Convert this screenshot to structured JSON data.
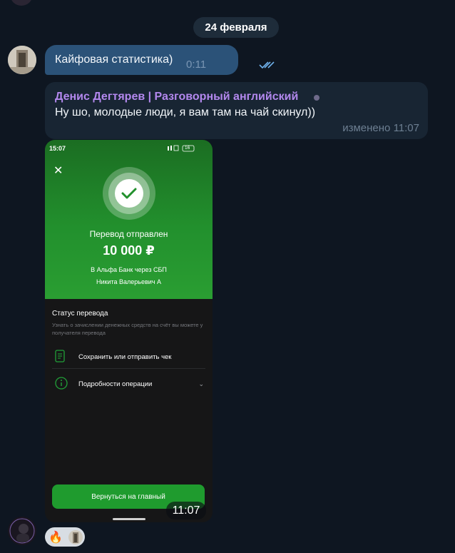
{
  "date_divider": "24 февраля",
  "messages": {
    "outgoing": {
      "text": "Кайфовая статистика)",
      "time": "0:11"
    },
    "incoming": {
      "sender": "Денис Дегтярев | Разговорный английский",
      "text": "Ну шо, молодые люди, я вам там на чай скинул))",
      "edited": "изменено 11:07"
    },
    "photo": {
      "time": "11:07",
      "screen": {
        "status_time": "15:07",
        "status_icons": "16",
        "title": "Перевод отправлен",
        "amount": "10 000 ₽",
        "bank": "В Альфа Банк через СБП",
        "recipient": "Никита Валерьевич А",
        "status_title": "Статус перевода",
        "status_desc": "Узнать о зачислении денежных средств на счёт вы можете у получателя перевода",
        "row_receipt": "Сохранить или отправить чек",
        "row_details": "Подробности операции",
        "return_button": "Вернуться на главный"
      }
    },
    "reaction": {
      "emoji": "🔥"
    }
  },
  "colors": {
    "background": "#0e1621",
    "bubble_in": "#182533",
    "bubble_out": "#2b5278",
    "sender_name": "#b388ee",
    "bank_green": "#22902d"
  }
}
